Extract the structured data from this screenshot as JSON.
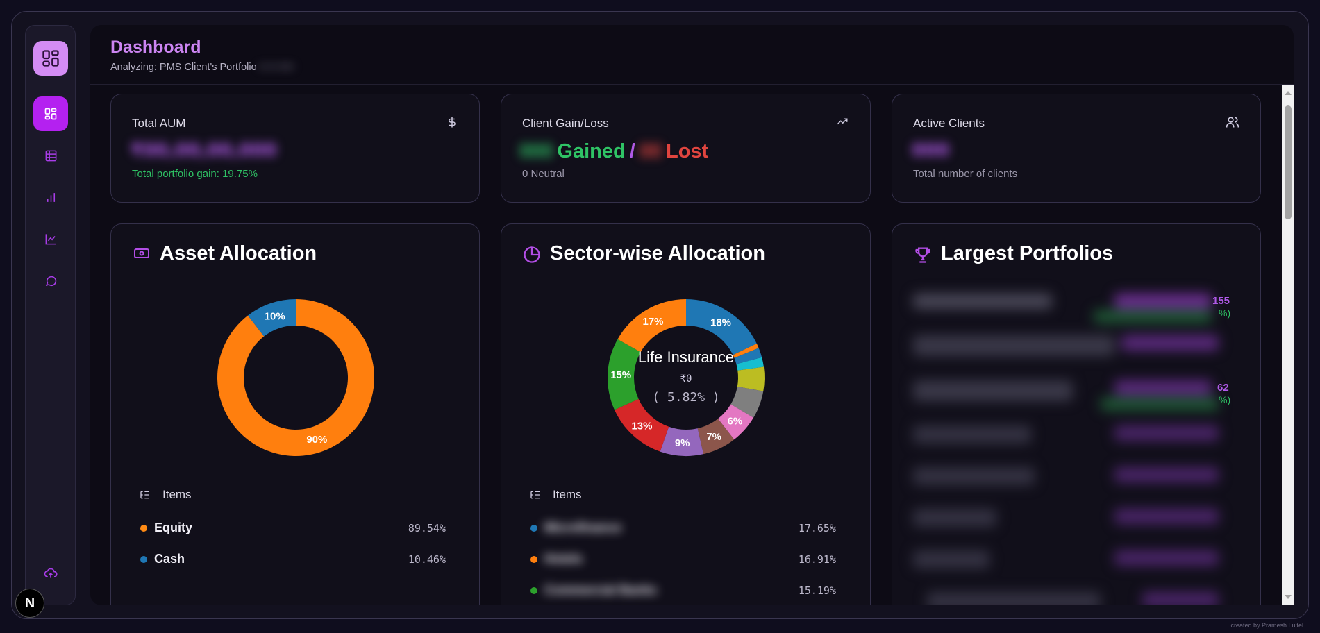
{
  "header": {
    "title": "Dashboard",
    "subtitle": "Analyzing: PMS Client's Portfolio",
    "subtitle_hidden": "•• •• ••••"
  },
  "sidebar": {
    "items": [
      {
        "icon": "dashboard-icon",
        "active": true
      },
      {
        "icon": "table-icon",
        "active": false
      },
      {
        "icon": "bar-chart-icon",
        "active": false
      },
      {
        "icon": "line-chart-icon",
        "active": false
      },
      {
        "icon": "chat-icon",
        "active": false
      }
    ],
    "bottom_icon": "upload-cloud-icon"
  },
  "stats": {
    "aum": {
      "title": "Total AUM",
      "value": "₹00,00,00,000",
      "sub": "Total portfolio gain: 19.75%"
    },
    "gainloss": {
      "title": "Client Gain/Loss",
      "gained_count": "000",
      "gained_label": "Gained",
      "sep": "/",
      "lost_count": "00",
      "lost_label": "Lost",
      "sub": "0 Neutral"
    },
    "clients": {
      "title": "Active Clients",
      "value": "000",
      "sub": "Total number of clients"
    }
  },
  "asset_allocation": {
    "title": "Asset Allocation",
    "items_label": "Items",
    "legend": [
      {
        "label": "Equity",
        "value": "89.54%",
        "color": "#ff8a14"
      },
      {
        "label": "Cash",
        "value": "10.46%",
        "color": "#1f77b4"
      }
    ]
  },
  "sector_allocation": {
    "title": "Sector-wise Allocation",
    "items_label": "Items",
    "center_label": "Life Insurance",
    "center_value": "₹0",
    "center_pct": "( 5.82% )",
    "legend": [
      {
        "label": "Microfinance",
        "value": "17.65%",
        "color": "#1f77b4"
      },
      {
        "label": "Hotels",
        "value": "16.91%",
        "color": "#ff7f0e"
      },
      {
        "label": "Commercial Banks",
        "value": "15.19%",
        "color": "#2ca02c"
      }
    ]
  },
  "largest_portfolios": {
    "title": "Largest Portfolios",
    "visible_fragments": [
      "155",
      "%)",
      "62",
      "%)"
    ]
  },
  "chart_data": [
    {
      "type": "pie",
      "title": "Asset Allocation",
      "categories": [
        "Equity",
        "Cash"
      ],
      "values": [
        89.54,
        10.46
      ],
      "slice_labels": [
        "90%",
        "10%"
      ],
      "colors": [
        "#ff7f0e",
        "#1f77b4"
      ]
    },
    {
      "type": "pie",
      "title": "Sector-wise Allocation",
      "values": [
        18,
        1,
        2,
        2,
        5,
        5.82,
        6,
        7,
        9,
        13,
        15,
        17
      ],
      "slice_labels": [
        "18%",
        "",
        "",
        "",
        "",
        "",
        "6%",
        "7%",
        "9%",
        "13%",
        "15%",
        "17%"
      ],
      "colors": [
        "#1f77b4",
        "#ff7f0e",
        "#1f77b4",
        "#17becf",
        "#bcbd22",
        "#7f7f7f",
        "#e377c2",
        "#8c564b",
        "#9467bd",
        "#d62728",
        "#2ca02c",
        "#ff7f0e"
      ]
    }
  ],
  "footer": {
    "credit": "created by Pramesh Luitel",
    "fab_label": "N"
  }
}
